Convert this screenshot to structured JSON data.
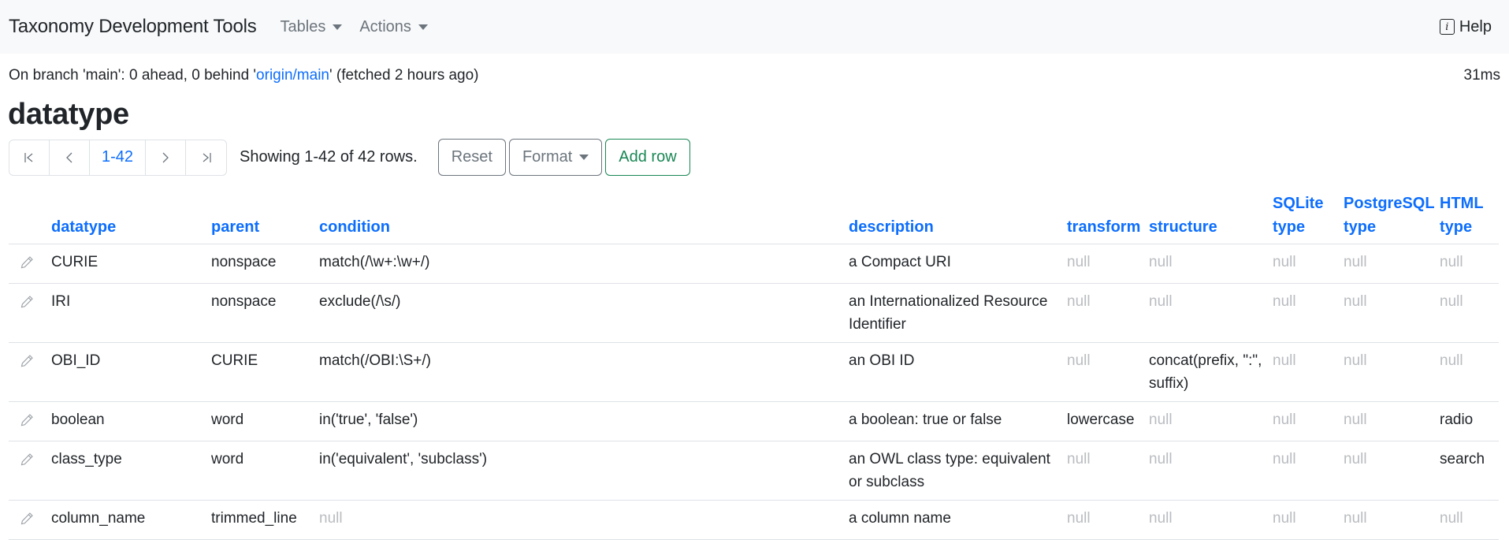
{
  "navbar": {
    "brand": "Taxonomy Development Tools",
    "menus": [
      {
        "label": "Tables",
        "icon": "caret-down-icon"
      },
      {
        "label": "Actions",
        "icon": "caret-down-icon"
      }
    ],
    "help": {
      "label": "Help",
      "icon": "info-icon",
      "icon_glyph": "i"
    }
  },
  "status": {
    "prefix": "On branch 'main': 0 ahead, 0 behind '",
    "remote": "origin/main",
    "suffix": "' (fetched 2 hours ago)",
    "timing": "31ms"
  },
  "page": {
    "title": "datatype"
  },
  "toolbar": {
    "pager": {
      "first": "|<",
      "prev": "<",
      "range": "1-42",
      "next": ">",
      "last": ">|"
    },
    "showing": "Showing 1-42 of 42 rows.",
    "reset_label": "Reset",
    "format_label": "Format",
    "add_row_label": "Add row"
  },
  "table": {
    "columns": [
      {
        "key": "datatype",
        "label": "datatype"
      },
      {
        "key": "parent",
        "label": "parent"
      },
      {
        "key": "condition",
        "label": "condition"
      },
      {
        "key": "description",
        "label": "description"
      },
      {
        "key": "transform",
        "label": "transform"
      },
      {
        "key": "structure",
        "label": "structure"
      },
      {
        "key": "sqlite_type",
        "label": "SQLite type"
      },
      {
        "key": "postgresql_type",
        "label": "PostgreSQL type"
      },
      {
        "key": "html_type",
        "label": "HTML type"
      }
    ],
    "null_text": "null",
    "rows": [
      {
        "datatype": "CURIE",
        "parent": "nonspace",
        "condition": "match(/\\w+:\\w+/)",
        "description": "a Compact URI",
        "transform": null,
        "structure": null,
        "sqlite_type": null,
        "postgresql_type": null,
        "html_type": null
      },
      {
        "datatype": "IRI",
        "parent": "nonspace",
        "condition": "exclude(/\\s/)",
        "description": "an Internationalized Resource Identifier",
        "transform": null,
        "structure": null,
        "sqlite_type": null,
        "postgresql_type": null,
        "html_type": null
      },
      {
        "datatype": "OBI_ID",
        "parent": "CURIE",
        "condition": "match(/OBI:\\S+/)",
        "description": "an OBI ID",
        "transform": null,
        "structure": "concat(prefix, \":\", suffix)",
        "sqlite_type": null,
        "postgresql_type": null,
        "html_type": null
      },
      {
        "datatype": "boolean",
        "parent": "word",
        "condition": "in('true', 'false')",
        "description": "a boolean: true or false",
        "transform": "lowercase",
        "structure": null,
        "sqlite_type": null,
        "postgresql_type": null,
        "html_type": "radio"
      },
      {
        "datatype": "class_type",
        "parent": "word",
        "condition": "in('equivalent', 'subclass')",
        "description": "an OWL class type: equivalent or subclass",
        "transform": null,
        "structure": null,
        "sqlite_type": null,
        "postgresql_type": null,
        "html_type": "search"
      },
      {
        "datatype": "column_name",
        "parent": "trimmed_line",
        "condition": null,
        "description": "a column name",
        "transform": null,
        "structure": null,
        "sqlite_type": null,
        "postgresql_type": null,
        "html_type": null
      }
    ]
  }
}
